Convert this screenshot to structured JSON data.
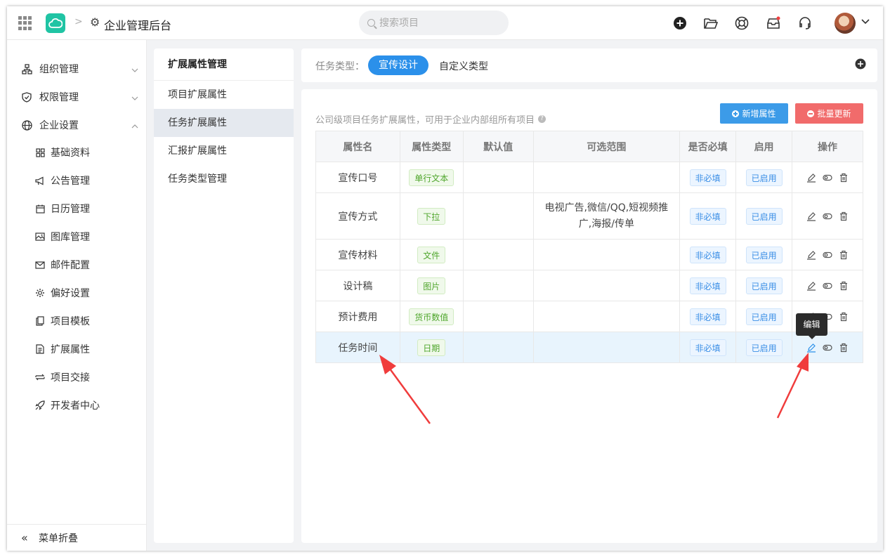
{
  "header": {
    "title": "企业管理后台",
    "search_placeholder": "搜索项目"
  },
  "sidebar": {
    "items": [
      {
        "label": "组织管理",
        "icon": "org-tree-icon"
      },
      {
        "label": "权限管理",
        "icon": "shield-icon"
      },
      {
        "label": "企业设置",
        "icon": "globe-icon"
      },
      {
        "label": "基础资料",
        "icon": "grid-icon"
      },
      {
        "label": "公告管理",
        "icon": "megaphone-icon"
      },
      {
        "label": "日历管理",
        "icon": "calendar-icon"
      },
      {
        "label": "图库管理",
        "icon": "image-icon"
      },
      {
        "label": "邮件配置",
        "icon": "mail-icon"
      },
      {
        "label": "偏好设置",
        "icon": "gear-icon"
      },
      {
        "label": "项目模板",
        "icon": "copy-icon"
      },
      {
        "label": "扩展属性",
        "icon": "document-icon"
      },
      {
        "label": "项目交接",
        "icon": "swap-icon"
      },
      {
        "label": "开发者中心",
        "icon": "rocket-icon"
      }
    ],
    "collapse_label": "菜单折叠"
  },
  "panel": {
    "title": "扩展属性管理",
    "items": [
      "项目扩展属性",
      "任务扩展属性",
      "汇报扩展属性",
      "任务类型管理"
    ]
  },
  "typebar": {
    "label": "任务类型：",
    "active": "宣传设计",
    "other": "自定义类型"
  },
  "main": {
    "description": "公司级项目任务扩展属性，可用于企业内部组所有项目",
    "add_button": "新增属性",
    "update_button": "批量更新"
  },
  "table": {
    "headers": [
      "属性名",
      "属性类型",
      "默认值",
      "可选范围",
      "是否必填",
      "启用",
      "操作"
    ],
    "rows": [
      {
        "name": "宣传口号",
        "type": "单行文本",
        "default": "",
        "range": "",
        "required": "非必填",
        "enabled": "已启用"
      },
      {
        "name": "宣传方式",
        "type": "下拉",
        "default": "",
        "range": "电视广告,微信/QQ,短视频推广,海报/传单",
        "required": "非必填",
        "enabled": "已启用"
      },
      {
        "name": "宣传材料",
        "type": "文件",
        "default": "",
        "range": "",
        "required": "非必填",
        "enabled": "已启用"
      },
      {
        "name": "设计稿",
        "type": "图片",
        "default": "",
        "range": "",
        "required": "非必填",
        "enabled": "已启用"
      },
      {
        "name": "预计费用",
        "type": "货币数值",
        "default": "",
        "range": "",
        "required": "非必填",
        "enabled": "已启用"
      },
      {
        "name": "任务时间",
        "type": "日期",
        "default": "",
        "range": "",
        "required": "非必填",
        "enabled": "已启用"
      }
    ]
  },
  "tooltip": "编辑",
  "colors": {
    "primary": "#2b90ea",
    "danger": "#f16b6b",
    "annotation": "#f03c3c",
    "logo": "#20c4a4"
  }
}
